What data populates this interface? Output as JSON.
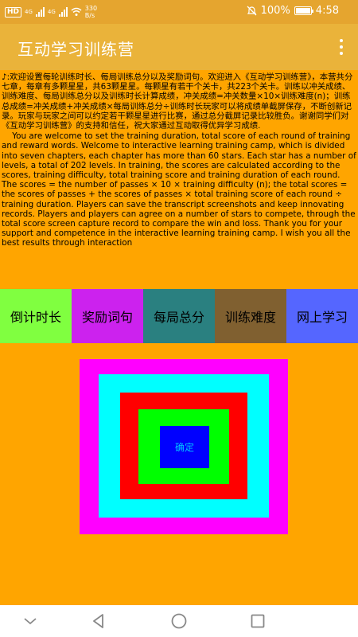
{
  "status_bar": {
    "hd": "HD",
    "net_type_1": "4G",
    "net_type_2": "4G",
    "net_speed_value": "330",
    "net_speed_unit": "B/s",
    "battery": "100%",
    "time": "4:58"
  },
  "app_bar": {
    "title": "互动学习训练营"
  },
  "description": {
    "zh": "♪:欢迎设置每轮训练时长、每局训练总分以及奖励词句。欢迎进入《互动学习训练营》，本营共分七章，每章有多颗星星，共63颗星星。每颗星有若干个关卡，共223个关卡。训练以冲关成绩、训练难度、每局训练总分以及训练时长计算成绩，冲关成绩=冲关数量×10×训练难度(n)；训练总成绩=冲关成绩+冲关成绩×每局训练总分÷训练时长玩家可以将成绩单截屏保存，不断创新记录。玩家与玩家之间可以约定若干颗星星进行比赛，通过总分截屏记录比较胜负。谢谢同学们对《互动学习训练营》的支持和信任，祝大家通过互动取得优异学习成绩.",
    "en": "    You are welcome to set the training duration, total score of each round of training and reward words. Welcome to interactive learning training camp, which is divided into seven chapters, each chapter has more than 60 stars. Each star has a number of levels, a total of 202 levels. In training, the scores are calculated according to the scores, training difficulty, total training score and training duration of each round. The scores = the number of passes × 10 × training difficulty (n); the total scores = the scores of passes + the scores of passes × total training score of each round ÷ training duration. Players can save the transcript screenshots and keep innovating records. Players and players can agree on a number of stars to compete, through the total score screen capture record to compare the win and loss. Thank you for your support and competence in the interactive learning training camp. I wish you all the best results through interaction"
  },
  "nav_buttons": [
    {
      "label": "倒计时长",
      "color": "#80ff40"
    },
    {
      "label": "奖励词句",
      "color": "#cc22ee"
    },
    {
      "label": "每局总分",
      "color": "#2a8080"
    },
    {
      "label": "训练难度",
      "color": "#806030"
    },
    {
      "label": "网上学习",
      "color": "#5566ff"
    }
  ],
  "confirm_button": {
    "label": "确定"
  },
  "colors": {
    "background": "#ffa500",
    "app_bar": "#eab33a",
    "status_bar": "#e5a52f"
  },
  "battery_level": 1.0,
  "icons": {
    "menu": "more-vert-icon",
    "back": "back-triangle-icon",
    "home": "home-circle-icon",
    "recents": "recents-square-icon",
    "collapse": "chevron-down-icon"
  }
}
